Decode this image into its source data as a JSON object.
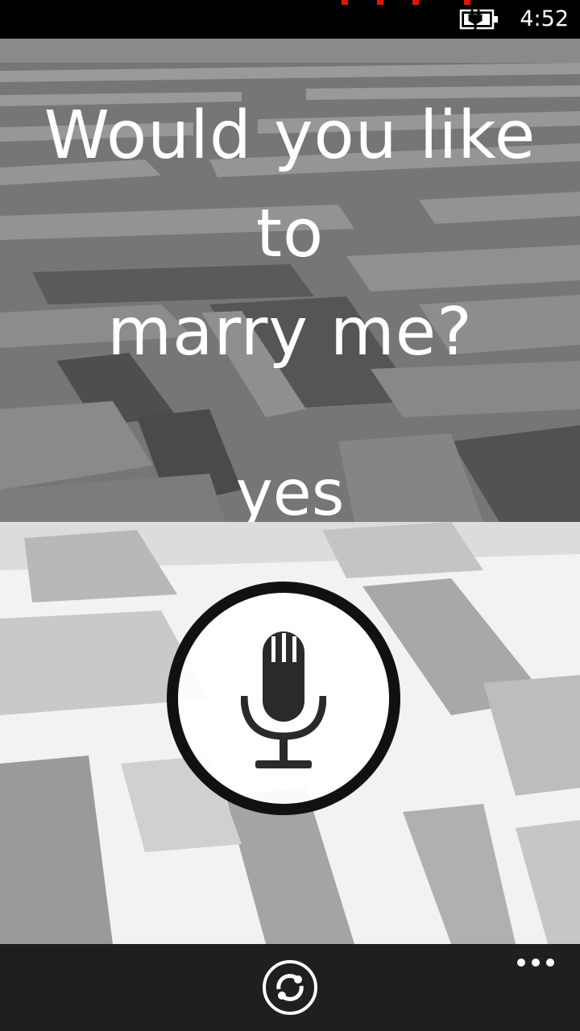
{
  "status_bar": {
    "time": "4:52",
    "battery_icon": "battery-charging-icon"
  },
  "question": {
    "line1": "Would you like to",
    "line2": "marry me?"
  },
  "answer": "yes",
  "mic_button": {
    "icon": "microphone-icon"
  },
  "app_bar": {
    "refresh_icon": "refresh-icon",
    "more_icon": "ellipsis-icon"
  },
  "colors": {
    "top_overlay": "#6e6e6e",
    "app_bar": "#1f1f1f",
    "accent": "#e51400"
  }
}
